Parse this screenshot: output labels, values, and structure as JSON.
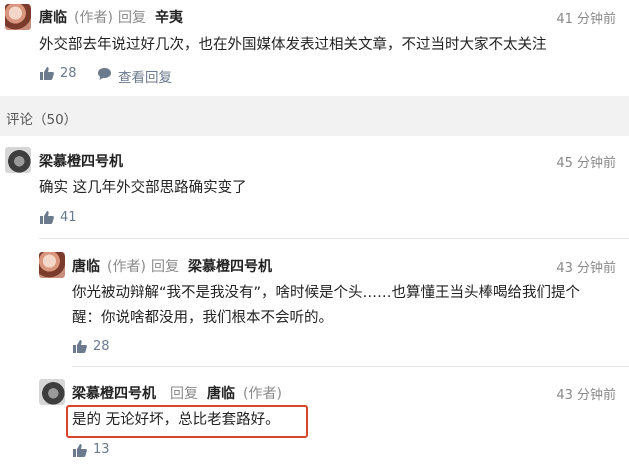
{
  "reply_top": {
    "author": "唐临",
    "author_tag": "(作者)",
    "reply_word": "回复",
    "reply_to": "辛夷",
    "time": "41 分钟前",
    "text": "外交部去年说过好几次，也在外国媒体发表过相关文章，不过当时大家不太关注",
    "likes": "28",
    "view_replies": "查看回复"
  },
  "comments_header": {
    "label": "评论（50）"
  },
  "comments": [
    {
      "author": "梁慕橙四号机",
      "time": "45 分钟前",
      "text": "确实 这几年外交部思路确实变了",
      "likes": "41"
    }
  ],
  "replies": [
    {
      "author": "唐临",
      "author_tag": "(作者)",
      "reply_word": "回复",
      "reply_to": "梁慕橙四号机",
      "time": "43 分钟前",
      "text_line1": "你光被动辩解“我不是我没有”，啥时候是个头……也算懂王当头棒喝给我们提个",
      "text_line2": "醒：你说啥都没用，我们根本不会听的。",
      "likes": "28"
    },
    {
      "author": "梁慕橙四号机",
      "reply_word": "回复",
      "reply_to": "唐临",
      "reply_to_tag": "(作者)",
      "time": "43 分钟前",
      "text": "是的 无论好坏，总比老套路好。",
      "likes": "13"
    }
  ],
  "colors": {
    "highlight_border": "#d9452b",
    "meta_gray": "#8a8a8a",
    "like_blue": "#6b7a8d"
  },
  "icons": {
    "like": "thumbs-up-icon",
    "replies": "speech-bubble-icon"
  }
}
